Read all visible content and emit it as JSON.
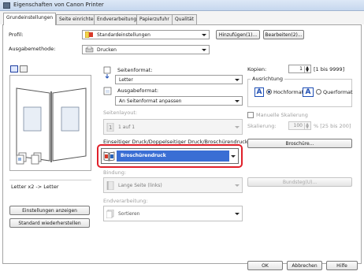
{
  "window": {
    "title": "Eigenschaften von Canon Printer"
  },
  "tabs": [
    {
      "label": "Grundeinstellungen",
      "active": true
    },
    {
      "label": "Seite einrichten",
      "active": false
    },
    {
      "label": "Endverarbeitung",
      "active": false
    },
    {
      "label": "Papierzufuhr",
      "active": false
    },
    {
      "label": "Qualität",
      "active": false
    }
  ],
  "profile": {
    "label": "Profil:",
    "value": "Standardeinstellungen",
    "add_button": "Hinzufügen(1)...",
    "edit_button": "Bearbeiten(2)..."
  },
  "output_method": {
    "label": "Ausgabemethode:",
    "value": "Drucken"
  },
  "page_size": {
    "label": "Seitenformat:",
    "value": "Letter"
  },
  "output_size": {
    "label": "Ausgabeformat:",
    "value": "An Seitenformat anpassen"
  },
  "page_layout": {
    "label": "Seitenlayout:",
    "value": "1 auf 1"
  },
  "copies": {
    "label": "Kopien:",
    "value": "1",
    "range": "[1 bis 9999]"
  },
  "orientation": {
    "label": "Ausrichtung",
    "portrait": "Hochformat",
    "landscape": "Querformat",
    "selected": "portrait"
  },
  "scaling": {
    "checkbox_label": "Manuelle Skalierung",
    "label": "Skalierung:",
    "value": "100",
    "range": "% [25 bis 200]"
  },
  "duplex": {
    "label": "Einseitiger Druck/Doppelseitiger Druck/Broschürendruck:",
    "value": "Broschürendruck",
    "booklet_button": "Broschüre..."
  },
  "binding": {
    "label": "Bindung:",
    "value": "Lange Seite (links)",
    "gutter_button": "Bundsteg(U)..."
  },
  "finishing": {
    "label": "Endverarbeitung:",
    "value": "Sortieren"
  },
  "preview": {
    "caption": "Letter x2 -> Letter"
  },
  "left_buttons": {
    "show_settings": "Einstellungen anzeigen",
    "restore_defaults": "Standard wiederherstellen"
  },
  "footer": {
    "ok": "OK",
    "cancel": "Abbrechen",
    "help": "Hilfe"
  },
  "colors": {
    "highlight": "#3a6ed4",
    "callout": "#e0202a",
    "tab_border": "#a4a4a4"
  }
}
